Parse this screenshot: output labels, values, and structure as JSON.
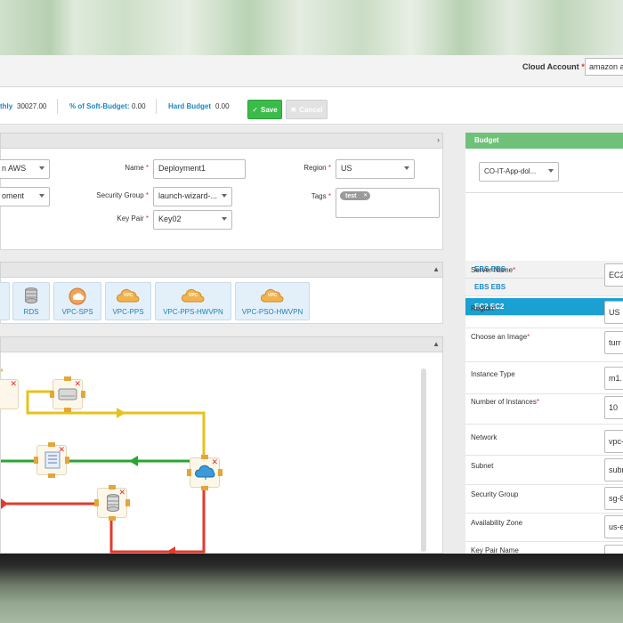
{
  "topbar": {
    "cloud_account_label": "Cloud Account",
    "cloud_account_required": "*",
    "cloud_account_value": "amazon a"
  },
  "budget_bar": {
    "monthly_label": "thly",
    "monthly_value": "30027.00",
    "soft_budget_label": "% of Soft-Budget:",
    "soft_budget_value": "0.00",
    "hard_budget_label": "Hard Budget",
    "hard_budget_value": "0.00",
    "save_label": "Save",
    "cancel_label": "Cancel"
  },
  "form": {
    "provider_value": "n AWS",
    "environment_value": "oment",
    "name_label": "Name",
    "name_value": "Deployment1",
    "security_group_label": "Security Group",
    "security_group_value": "launch-wizard-...",
    "key_pair_label": "Key Pair",
    "key_pair_value": "Key02",
    "region_label": "Region",
    "region_value": "US",
    "tags_label": "Tags",
    "tag_value": "test",
    "required_mark": "*"
  },
  "services": [
    {
      "label": "RDS",
      "icon": "database-icon"
    },
    {
      "label": "VPC-SPS",
      "icon": "cloud-icon"
    },
    {
      "label": "VPC-PPS",
      "icon": "vpc-cloud-icon",
      "badge": "VPC"
    },
    {
      "label": "VPC-PPS-HWVPN",
      "icon": "vpc-cloud-icon",
      "badge": "VPC"
    },
    {
      "label": "VPC-PSO-HWVPN",
      "icon": "vpc-cloud-icon",
      "badge": "VPC"
    }
  ],
  "connection_colors": {
    "yellow": "#e8c21b",
    "green": "#2aa52f",
    "red": "#e23a2b"
  },
  "right_panel": {
    "budget_header": "Budget",
    "budget_value": "CO-IT-App-dol...",
    "accordion": [
      "EBS EBS",
      "EBS EBS",
      "EC2 EC2"
    ],
    "fields": [
      {
        "label": "Server Name",
        "required": true,
        "value": "EC2"
      },
      {
        "label": "Region",
        "required": true,
        "value": "US"
      },
      {
        "label": "Choose an Image",
        "required": true,
        "value": "turr"
      },
      {
        "label": "Instance Type",
        "required": false,
        "value": "m1."
      },
      {
        "label": "Number of Instances",
        "required": true,
        "value": "10"
      },
      {
        "label": "Network",
        "required": false,
        "value": "vpc-"
      },
      {
        "label": "Subnet",
        "required": false,
        "value": "subr"
      },
      {
        "label": "Security Group",
        "required": false,
        "value": "sg-8"
      },
      {
        "label": "Availability Zone",
        "required": false,
        "value": "us-e"
      },
      {
        "label": "Key Pair Name",
        "required": false,
        "value": ""
      }
    ]
  }
}
